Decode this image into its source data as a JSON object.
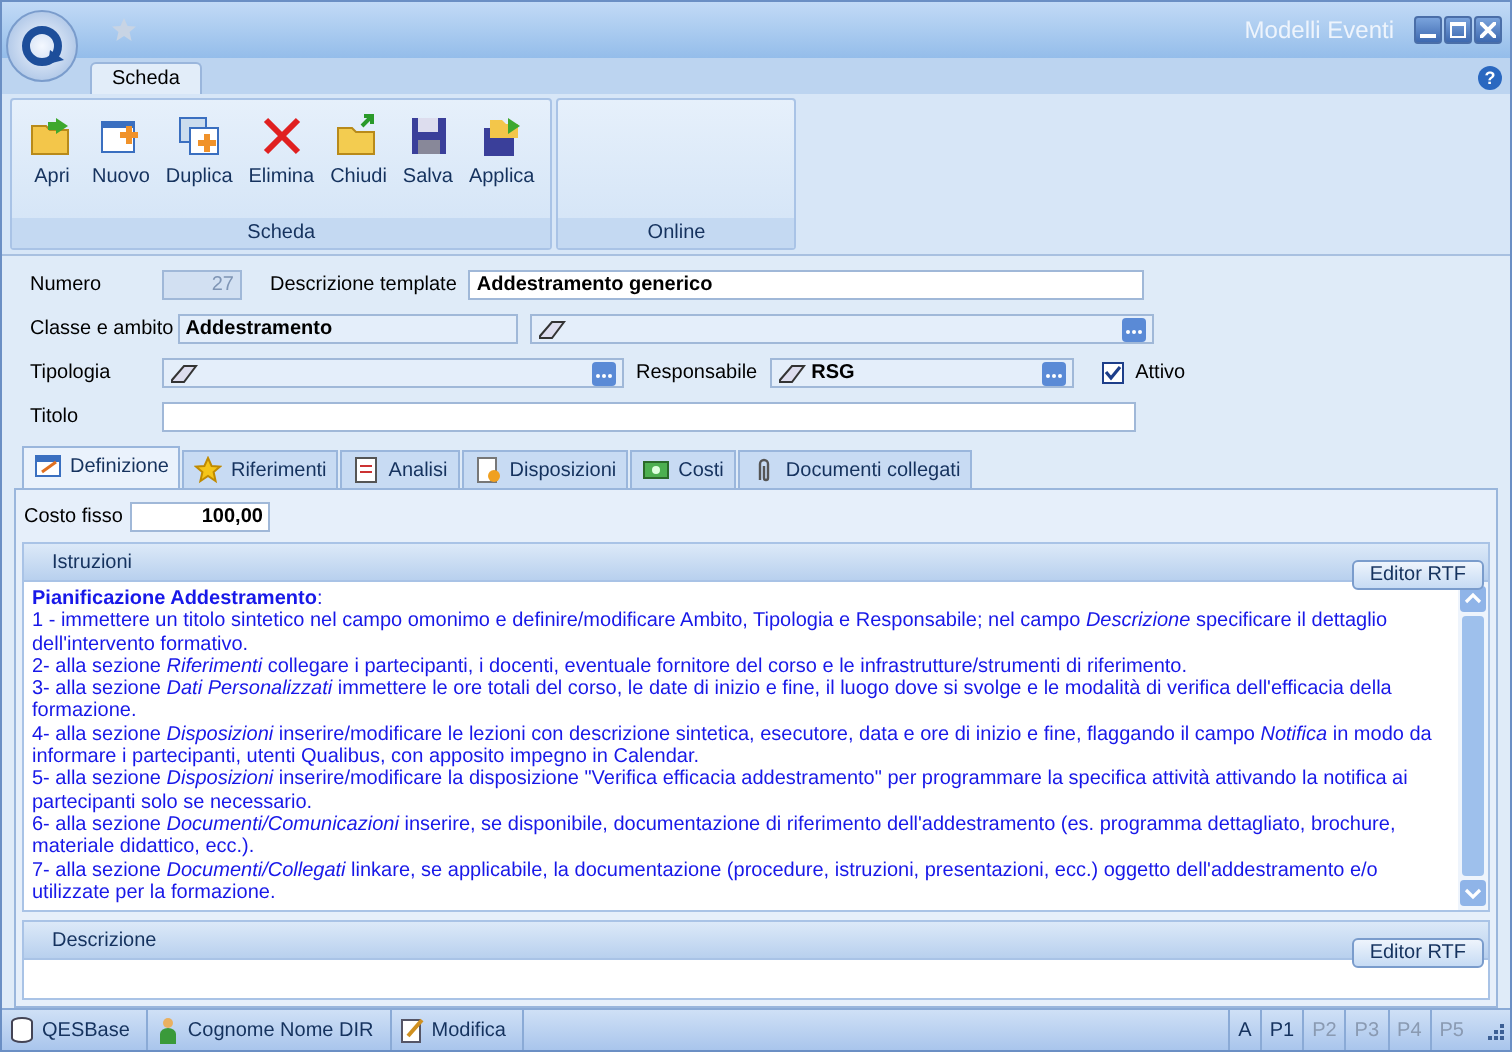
{
  "window": {
    "title": "Modelli Eventi",
    "help": "?"
  },
  "ribbon": {
    "tabs": [
      {
        "label": "Scheda",
        "selected": true
      }
    ],
    "groups": [
      {
        "title": "Scheda",
        "buttons": [
          {
            "kind": "open",
            "label": "Apri"
          },
          {
            "kind": "new",
            "label": "Nuovo"
          },
          {
            "kind": "duplicate",
            "label": "Duplica"
          },
          {
            "kind": "delete",
            "label": "Elimina"
          },
          {
            "kind": "close",
            "label": "Chiudi"
          },
          {
            "kind": "save",
            "label": "Salva"
          },
          {
            "kind": "apply",
            "label": "Applica"
          }
        ]
      },
      {
        "title": "Online"
      }
    ]
  },
  "form": {
    "numero": {
      "label": "Numero",
      "value": "27",
      "disabled": true
    },
    "descrizione_template": {
      "label": "Descrizione template",
      "value": "Addestramento generico"
    },
    "classe_e_ambito": {
      "label": "Classe e ambito",
      "value": "Addestramento"
    },
    "tipologia": {
      "label": "Tipologia"
    },
    "responsabile": {
      "label": "Responsabile",
      "value": "RSG"
    },
    "attivo": {
      "label": "Attivo",
      "checked": true
    },
    "titolo": {
      "label": "Titolo"
    }
  },
  "tabs": [
    {
      "kind": "definition",
      "label": "Definizione",
      "selected": true
    },
    {
      "kind": "star",
      "label": "Riferimenti",
      "selected": false
    },
    {
      "kind": "analysis",
      "label": "Analisi",
      "selected": false
    },
    {
      "kind": "dispositions",
      "label": "Disposizioni",
      "selected": false
    },
    {
      "kind": "money",
      "label": "Costi",
      "selected": false
    },
    {
      "kind": "clip",
      "label": "Documenti collegati",
      "selected": false
    }
  ],
  "costo_fisso": {
    "label": "Costo fisso",
    "value": "100,00"
  },
  "istruzioni": {
    "title": "Istruzioni",
    "button": "Editor RTF",
    "lines": [
      "**Pianificazione Addestramento**:",
      "1 - immettere un titolo sintetico nel campo omonimo e definire/modificare Ambito, Tipologia e Responsabile; nel campo *Descrizione* specificare il dettaglio dell'intervento formativo.",
      "2- alla sezione *Riferimenti* collegare i partecipanti, i docenti, eventuale fornitore del corso e le infrastrutture/strumenti di riferimento.",
      "3- alla sezione *Dati Personalizzati* immettere le ore totali del corso, le date di inizio e fine, il luogo dove si svolge e le modalità di verifica dell'efficacia della formazione.",
      "4- alla sezione *Disposizioni* inserire/modificare le lezioni con descrizione sintetica, esecutore, data e ore di inizio e fine, flaggando il campo *Notifica* in modo da informare i partecipanti, utenti Qualibus, con apposito impegno in Calendar.",
      "5- alla sezione *Disposizioni* inserire/modificare la disposizione \"Verifica efficacia addestramento\" per programmare la specifica attività attivando la notifica ai partecipanti solo se necessario.",
      "6- alla sezione *Documenti/Comunicazioni* inserire, se disponibile, documentazione di riferimento dell'addestramento (es. programma dettagliato, brochure, materiale didattico, ecc.).",
      "7- alla sezione *Documenti/Collegati* linkare, se applicabile, la documentazione (procedure, istruzioni, presentazioni, ecc.) oggetto dell'addestramento e/o utilizzate per la formazione."
    ]
  },
  "descrizione": {
    "title": "Descrizione",
    "button": "Editor RTF"
  },
  "status_bar": {
    "items": [
      {
        "kind": "database",
        "label": "QESBase"
      },
      {
        "kind": "user",
        "label": "Cognome Nome DIR"
      },
      {
        "kind": "edit",
        "label": "Modifica"
      }
    ],
    "pages": [
      {
        "label": "A",
        "disabled": false
      },
      {
        "label": "P1",
        "disabled": false
      },
      {
        "label": "P2",
        "disabled": true
      },
      {
        "label": "P3",
        "disabled": true
      },
      {
        "label": "P4",
        "disabled": true
      },
      {
        "label": "P5",
        "disabled": true
      }
    ]
  }
}
